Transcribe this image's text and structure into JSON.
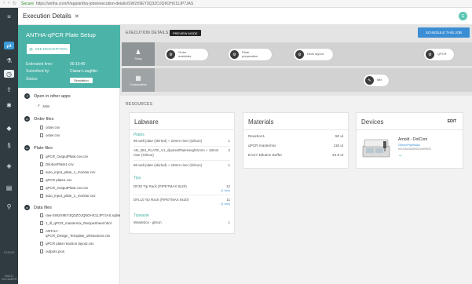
{
  "browser": {
    "secure_label": "Secure",
    "url": "https://antha.com/#/app/antha-jobs/execution-details/SW2X9EY3Q3ZOJQ6OHX11JP7JAS"
  },
  "window": {
    "title": "Execution Details",
    "close": "✕",
    "avatar": "G"
  },
  "rail": {
    "time": "10:30:00",
    "footer": "BUILD DOCUMENT"
  },
  "plate_setup": {
    "title": "ANTHA-qPCR Plate Setup",
    "see_description": "SEE DESCRIPTION",
    "estimated_time_label": "Estimated time:",
    "estimated_time": "00:10:40",
    "submitted_by_label": "Submitted by:",
    "submitted_by": "Ciaran Loughlin",
    "status_label": "Status:",
    "status": "Simulation"
  },
  "sections": {
    "open_in_other_apps": "Open in other apps",
    "jobs": "Jobs",
    "order_files": "Order files",
    "plate_files": "Plate files",
    "data_files": "Data files"
  },
  "order_files": [
    "order.csv",
    "order.csv"
  ],
  "plate_files": [
    "qPCR_OutputPlate.csv.csv",
    "DilutionPlate1.csv",
    "auto_input_plate_1_monitor.csv",
    "qPCR plate1.csv",
    "qPCR_OutputPlate.csv.csv",
    "auto_input_plate_1_monitor.csv"
  ],
  "data_files": [
    "raw-SW2X9EY3Q3ZOJQ6OHX11JP7JAS.sqlite",
    "1_ill_qPCR_mastermix_RecipeSheet.html",
    "ANTHA-",
    "qPCR_Design_Template_1Reactions.csv",
    "qPCR plate reaction layout.csv",
    "outputs.json"
  ],
  "toolbar": {
    "execution_details": "EXECUTION DETAILS",
    "preview_mode": "PREVIEW MODE",
    "schedule": "SCHEDULE THIS JOB"
  },
  "tabs": {
    "setup": "Setup",
    "consumables": "Consumables"
  },
  "steps": [
    {
      "label1": "Order",
      "label2": "materials",
      "icon": "gear-icon"
    },
    {
      "label1": "Plate",
      "label2": "preparation",
      "icon": "gear-icon"
    },
    {
      "label1": "Deck layout",
      "label2": "",
      "icon": "gear-icon"
    },
    {
      "label1": "QPCR",
      "label2": "",
      "icon": "gear-icon"
    },
    {
      "label1": "Mix",
      "label2": "",
      "icon": "pipette-icon"
    }
  ],
  "resources_label": "RESOURCES",
  "labware": {
    "title": "Labware",
    "plates_label": "Plates",
    "plates": [
      {
        "name": "96 well plate (skirted) + 20mm riser (Gilson)",
        "count": "1"
      },
      {
        "name": "AB_384_PLATE_V1_djustedPlateHeight1mm + 18mm riser (Gilson)",
        "count": "2"
      },
      {
        "name": "96 well plate (skirted) + 18mm riser (Gilson)",
        "count": "1"
      }
    ],
    "tips_label": "Tips",
    "tips": [
      {
        "name": "DF30 Tip Rack (PIPETMAX 8x20)",
        "count": "12",
        "boxes": "(1 box)"
      },
      {
        "name": "DFL10 Tip Rack (PIPETMAX 8x20)",
        "count": "11",
        "boxes": "(1 box)"
      }
    ],
    "tipwaste_label": "Tipwaste",
    "tipwaste": [
      {
        "name": "Wastebox - gilson",
        "count": "1"
      }
    ]
  },
  "materials": {
    "title": "Materials",
    "items": [
      {
        "name": "Reaction1",
        "amount": "50 ul"
      },
      {
        "name": "qPCR mastermix",
        "amount": "118 ul"
      },
      {
        "name": "EASY Dilution Buffer",
        "amount": "33.9 ul"
      }
    ]
  },
  "devices": {
    "title": "Devices",
    "edit": "EDIT",
    "name": "Arnold - DotCom",
    "model": "GilsonPipetMax",
    "id": "c02118d0a366ff162c9d9ff193"
  }
}
